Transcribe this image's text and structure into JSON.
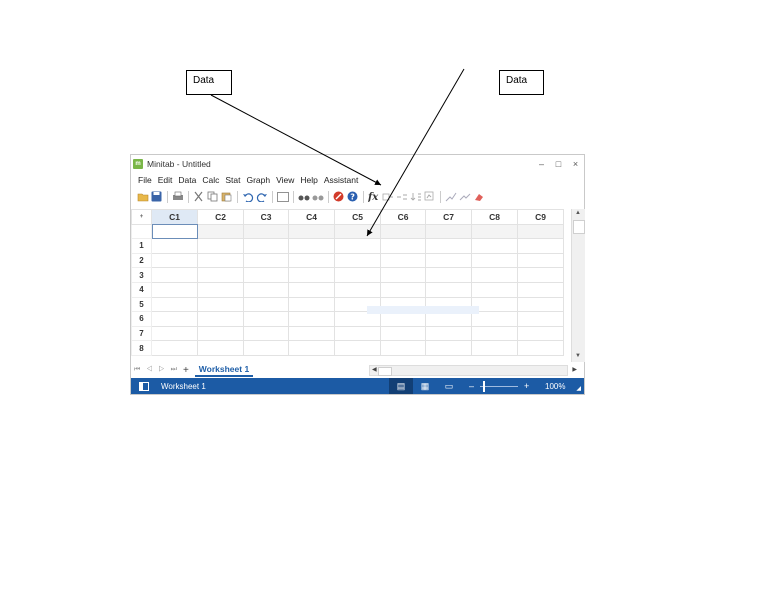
{
  "callouts": {
    "left": "Data",
    "right": "Data"
  },
  "window": {
    "title": "Minitab - Untitled",
    "logo_text": "m",
    "controls": {
      "minimize": "–",
      "maximize": "□",
      "close": "×"
    }
  },
  "menu": [
    "File",
    "Edit",
    "Data",
    "Calc",
    "Stat",
    "Graph",
    "View",
    "Help",
    "Assistant"
  ],
  "toolbar_icons": [
    "open-icon",
    "save-icon",
    "print-icon",
    "cut-icon",
    "copy-icon",
    "paste-icon",
    "undo-icon",
    "redo-icon",
    "window-icon",
    "find-icon",
    "replace-icon",
    "cancel-icon",
    "help-icon",
    "function-icon",
    "insert-rows-icon",
    "insert-columns-icon",
    "sort-icon",
    "edit-graph-icon",
    "brush-icon",
    "link-icon",
    "eraser-icon"
  ],
  "grid": {
    "corner": "+",
    "columns": [
      "C1",
      "C2",
      "C3",
      "C4",
      "C5",
      "C6",
      "C7",
      "C8",
      "C9"
    ],
    "rows": [
      "1",
      "2",
      "3",
      "4",
      "5",
      "6",
      "7",
      "8"
    ]
  },
  "tabs": {
    "nav": "⏮ ◁ ▷ ⏭",
    "add": "+",
    "active": "Worksheet 1"
  },
  "statusbar": {
    "label": "Worksheet 1",
    "zoom_minus": "–",
    "zoom_plus": "+",
    "zoom_percent": "100%"
  }
}
